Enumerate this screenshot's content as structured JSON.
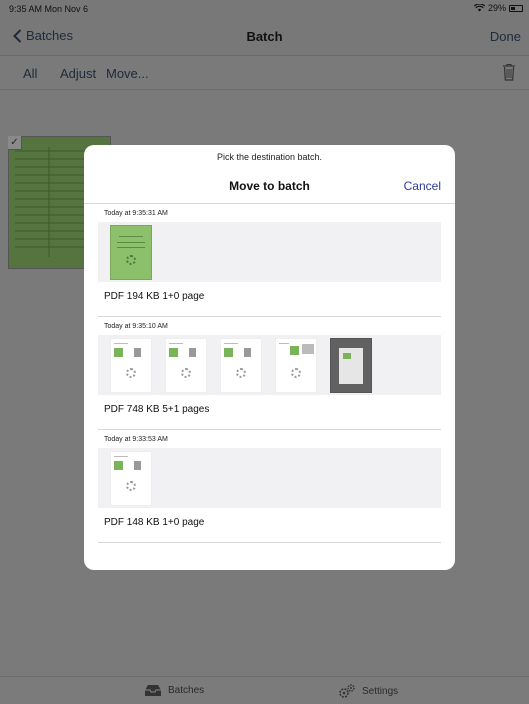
{
  "status_bar": {
    "time": "9:35 AM  Mon Nov 6",
    "battery": "29%"
  },
  "nav": {
    "back_label": "Batches",
    "title": "Batch",
    "done_label": "Done"
  },
  "toolbar": {
    "all": "All",
    "adjust": "Adjust",
    "move": "Move..."
  },
  "modal": {
    "subtitle": "Pick the destination batch.",
    "title": "Move to batch",
    "cancel": "Cancel",
    "batches": [
      {
        "date": "Today at 9:35:31 AM",
        "info": "PDF  194 KB  1+0 page"
      },
      {
        "date": "Today at 9:35:10 AM",
        "info": "PDF  748 KB  5+1 pages"
      },
      {
        "date": "Today at 9:33:53 AM",
        "info": "PDF  148 KB  1+0 page"
      }
    ]
  },
  "tabbar": {
    "batches": "Batches",
    "settings": "Settings"
  },
  "colors": {
    "accent": "#2f3a9a",
    "dim_background": "#7a7a7a",
    "document_green": "#8cc06a"
  }
}
